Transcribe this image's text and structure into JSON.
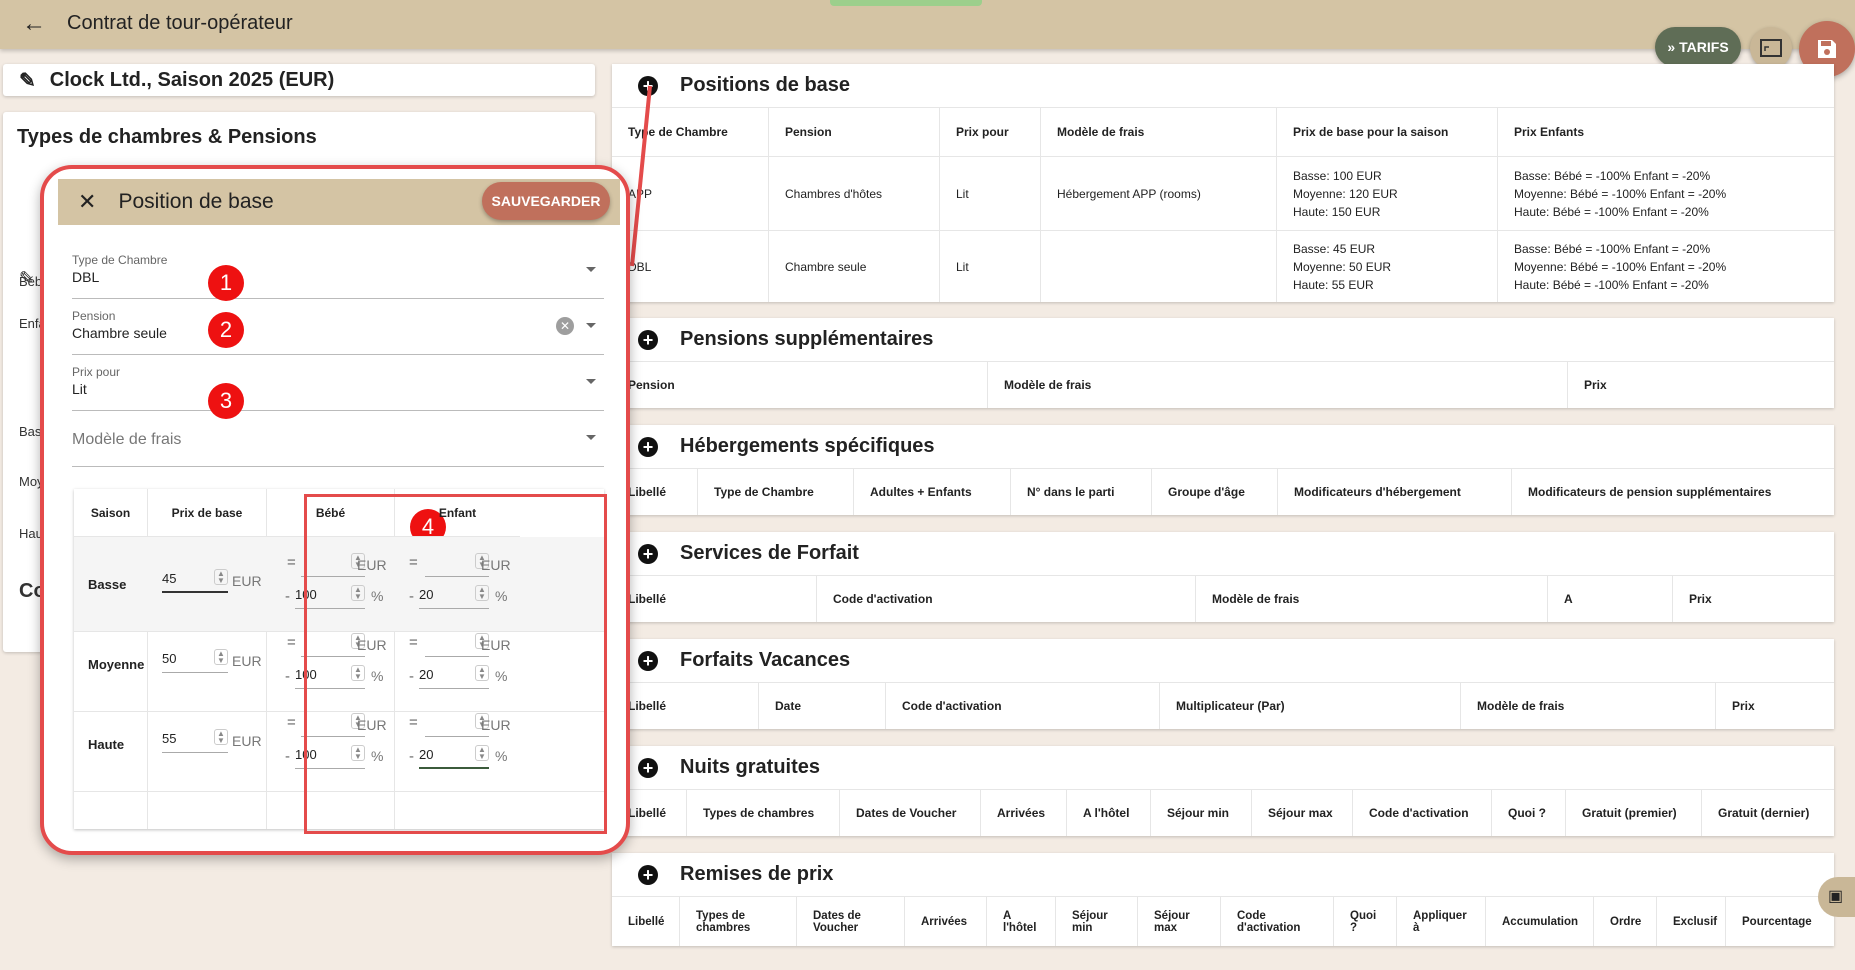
{
  "app": {
    "title": "Contrat de tour-opérateur",
    "tarifs_label": "TARIFS"
  },
  "left": {
    "contract_name": "Clock Ltd., Saison 2025 (EUR)",
    "types_heading": "Types de chambres & Pensions",
    "stubs": [
      "Béb",
      "Enfa",
      "Bas",
      "Moy",
      "Hau",
      "Co"
    ]
  },
  "sections": {
    "base": {
      "title": "Positions de base",
      "columns": [
        "Type de Chambre",
        "Pension",
        "Prix pour",
        "Modèle de frais",
        "Prix de base pour la saison",
        "Prix Enfants"
      ],
      "rows": [
        {
          "room": "APP",
          "pension": "Chambres d'hôtes",
          "per": "Lit",
          "fee": "Hébergement APP (rooms)",
          "base": [
            "Basse:   100 EUR",
            "Moyenne:   120 EUR",
            "Haute:   150 EUR"
          ],
          "kids": [
            "Basse:   Bébé = -100%   Enfant = -20%",
            "Moyenne:   Bébé = -100%   Enfant = -20%",
            "Haute:   Bébé = -100%   Enfant = -20%"
          ]
        },
        {
          "room": "DBL",
          "pension": "Chambre seule",
          "per": "Lit",
          "fee": "",
          "base": [
            "Basse:   45 EUR",
            "Moyenne:   50 EUR",
            "Haute:   55 EUR"
          ],
          "kids": [
            "Basse:   Bébé = -100%   Enfant = -20%",
            "Moyenne:   Bébé = -100%   Enfant = -20%",
            "Haute:   Bébé = -100%   Enfant = -20%"
          ]
        }
      ]
    },
    "pensions": {
      "title": "Pensions supplémentaires",
      "columns": [
        "Pension",
        "Modèle de frais",
        "Prix"
      ]
    },
    "hebergements": {
      "title": "Hébergements spécifiques",
      "columns": [
        "Libellé",
        "Type de Chambre",
        "Adultes + Enfants",
        "N° dans le parti",
        "Groupe d'âge",
        "Modificateurs d'hébergement",
        "Modificateurs de pension supplémentaires"
      ]
    },
    "services": {
      "title": "Services de Forfait",
      "columns": [
        "Libellé",
        "Code d'activation",
        "Modèle de frais",
        "A",
        "Prix"
      ]
    },
    "forfaits": {
      "title": "Forfaits Vacances",
      "columns": [
        "Libellé",
        "Date",
        "Code d'activation",
        "Multiplicateur (Par)",
        "Modèle de frais",
        "Prix"
      ]
    },
    "nuits": {
      "title": "Nuits gratuites",
      "columns": [
        "Libellé",
        "Types de chambres",
        "Dates de Voucher",
        "Arrivées",
        "A l'hôtel",
        "Séjour min",
        "Séjour max",
        "Code d'activation",
        "Quoi ?",
        "Gratuit (premier)",
        "Gratuit (dernier)"
      ]
    },
    "remises": {
      "title": "Remises de prix",
      "columns": [
        "Libellé",
        "Types de chambres",
        "Dates de Voucher",
        "Arrivées",
        "A l'hôtel",
        "Séjour min",
        "Séjour max",
        "Code d'activation",
        "Quoi ?",
        "Appliquer à",
        "Accumulation",
        "Ordre",
        "Exclusif",
        "Pourcentage"
      ]
    }
  },
  "dialog": {
    "title": "Position de base",
    "save_label": "SAUVEGARDER",
    "room_type": {
      "label": "Type de Chambre",
      "value": "DBL"
    },
    "pension": {
      "label": "Pension",
      "value": "Chambre seule"
    },
    "price_per": {
      "label": "Prix pour",
      "value": "Lit"
    },
    "fee_model": {
      "placeholder": "Modèle de frais"
    },
    "badges": [
      "1",
      "2",
      "3",
      "4"
    ],
    "table": {
      "headers": {
        "season": "Saison",
        "base": "Prix de base",
        "baby": "Bébé",
        "child": "Enfant"
      },
      "eq": "=",
      "minus": "-",
      "eur": "EUR",
      "pct": "%",
      "rows": [
        {
          "season": "Basse",
          "base": "45",
          "baby_pct": "100",
          "child_pct": "20"
        },
        {
          "season": "Moyenne",
          "base": "50",
          "baby_pct": "100",
          "child_pct": "20"
        },
        {
          "season": "Haute",
          "base": "55",
          "baby_pct": "100",
          "child_pct": "20"
        }
      ]
    }
  }
}
